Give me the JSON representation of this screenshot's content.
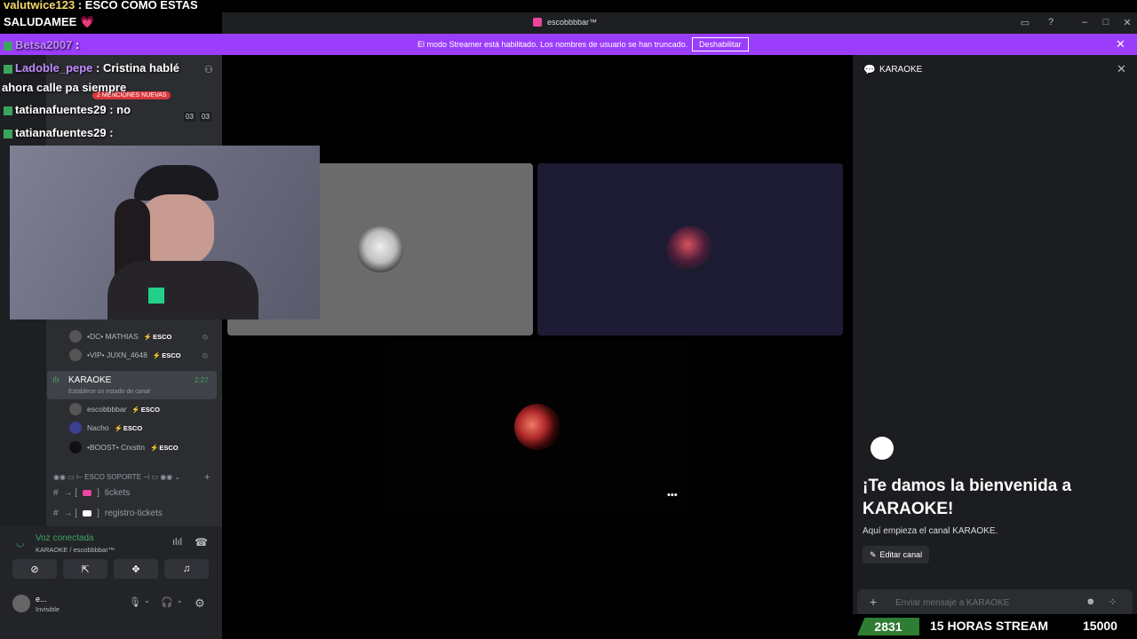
{
  "window": {
    "title": "escobbbbar™"
  },
  "banner": {
    "message": "El modo Streamer está habilitado. Los nombres de usuario se han truncado.",
    "disable_label": "Deshabilitar"
  },
  "overlay_chat": [
    {
      "user": "valutwice123",
      "text": ": ESCO COMO ESTAS"
    },
    {
      "user": "SALUDAMEE 💗",
      "text": ""
    },
    {
      "user": "Betsa2007",
      "text": ":"
    },
    {
      "user": "Ladoble_pepe",
      "text": ": Cristina hablé"
    },
    {
      "user": "",
      "text": "ahora calle pa siempre"
    },
    {
      "user": "tatianafuentes29",
      "text": ": no"
    },
    {
      "user": "tatianafuentes29",
      "text": ":"
    }
  ],
  "mentions_badge": "2 MENCIONES NUEVAS",
  "counters": [
    "03",
    "03"
  ],
  "sidebar": {
    "voice_users_a": [
      {
        "name": "•DC• MATHIAS",
        "tag": "ESCO"
      },
      {
        "name": "•VIP• JUXN_4648",
        "tag": "ESCO"
      }
    ],
    "karaoke_channel": {
      "name": "KARAOKE",
      "status": "Establece un estado de canal",
      "time": "2:27"
    },
    "karaoke_users": [
      {
        "name": "escobbbbar",
        "tag": "ESCO"
      },
      {
        "name": "Nacho",
        "tag": "ESCO"
      },
      {
        "name": "•BOOST• Crxsttn",
        "tag": "ESCO"
      }
    ],
    "category": "ESCO SOPORTE",
    "text_channels": [
      "tickets",
      "registro-tickets"
    ]
  },
  "voice_panel": {
    "status": "Voz conectada",
    "channel": "KARAOKE / escobbbbar™"
  },
  "user": {
    "name": "e...",
    "status": "Invisible"
  },
  "right_panel": {
    "title": "KARAOKE",
    "welcome": "¡Te damos la bienvenida a KARAOKE!",
    "subtitle": "Aquí empieza el canal KARAOKE.",
    "edit_label": "Editar canal",
    "message_placeholder": "Enviar mensaje a KARAOKE"
  },
  "stats": {
    "left_number": "2831",
    "label": "15 HORAS STREAM",
    "right_number": "15000"
  },
  "colors": {
    "banner": "#9b3dfc",
    "voice_green": "#3ba55d",
    "tile1": "#6b6b6b",
    "tile2": "#1d1b33"
  }
}
